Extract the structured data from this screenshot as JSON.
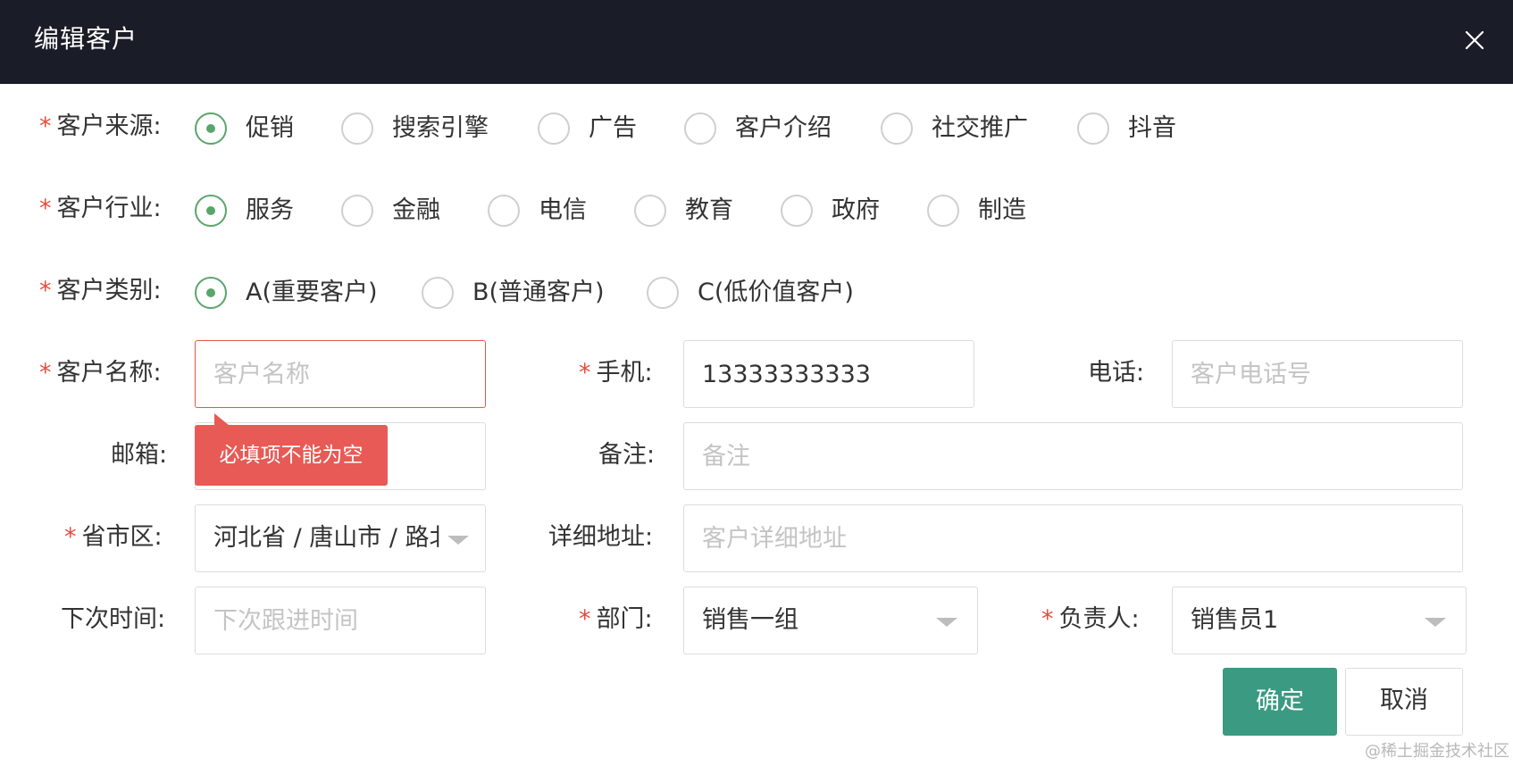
{
  "dialog": {
    "title": "编辑客户",
    "close_icon": "close-icon"
  },
  "form": {
    "required_mark": "*",
    "source": {
      "label": "客户来源:",
      "options": [
        "促销",
        "搜索引擎",
        "广告",
        "客户介绍",
        "社交推广",
        "抖音"
      ],
      "selected": "促销"
    },
    "industry": {
      "label": "客户行业:",
      "options": [
        "服务",
        "金融",
        "电信",
        "教育",
        "政府",
        "制造"
      ],
      "selected": "服务"
    },
    "category": {
      "label": "客户类别:",
      "options": [
        "A(重要客户)",
        "B(普通客户)",
        "C(低价值客户)"
      ],
      "selected": "A(重要客户)"
    },
    "name": {
      "label": "客户名称:",
      "value": "",
      "placeholder": "客户名称",
      "error": "必填项不能为空"
    },
    "mobile": {
      "label": "手机:",
      "value": "13333333333",
      "placeholder": ""
    },
    "phone": {
      "label": "电话:",
      "value": "",
      "placeholder": "客户电话号"
    },
    "email": {
      "label": "邮箱:",
      "value": "",
      "placeholder": ""
    },
    "remark": {
      "label": "备注:",
      "value": "",
      "placeholder": "备注"
    },
    "region": {
      "label": "省市区:",
      "value": "河北省 / 唐山市 / 路北"
    },
    "address": {
      "label": "详细地址:",
      "value": "",
      "placeholder": "客户详细地址"
    },
    "next_time": {
      "label": "下次时间:",
      "value": "",
      "placeholder": "下次跟进时间"
    },
    "department": {
      "label": "部门:",
      "value": "销售一组"
    },
    "owner": {
      "label": "负责人:",
      "value": "销售员1"
    }
  },
  "buttons": {
    "confirm": "确定",
    "cancel": "取消"
  },
  "colors": {
    "header_bg": "#1a1d27",
    "accent": "#3b9a82",
    "radio_checked": "#5aa56c",
    "error": "#e85a55",
    "required": "#e74c3c"
  },
  "watermark": "@稀土掘金技术社区"
}
